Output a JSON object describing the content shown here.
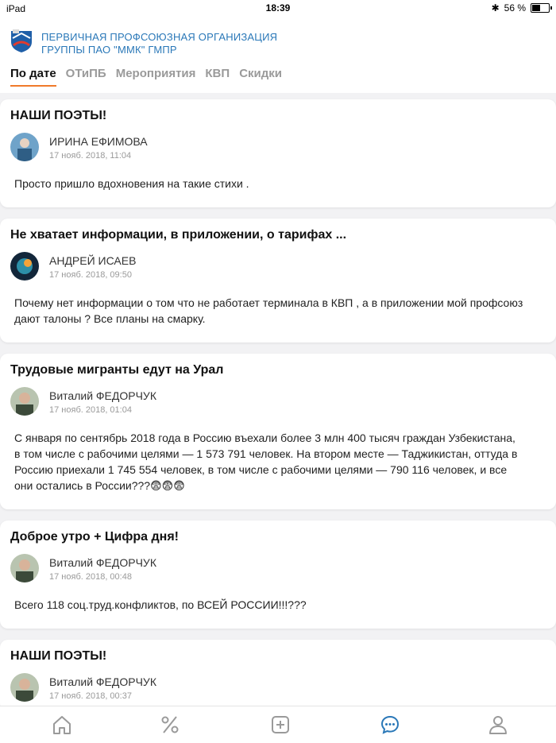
{
  "status_bar": {
    "left": "iPad",
    "time": "18:39",
    "battery_text": "56 %",
    "battery_level": 0.56
  },
  "header": {
    "org_line1": "ПЕРВИЧНАЯ ПРОФСОЮЗНАЯ ОРГАНИЗАЦИЯ",
    "org_line2": "ГРУППЫ ПАО \"ММК\" ГМПР",
    "tabs": [
      {
        "label": "По дате",
        "active": true
      },
      {
        "label": "ОТиПБ"
      },
      {
        "label": "Мероприятия"
      },
      {
        "label": "КВП"
      },
      {
        "label": "Скидки"
      }
    ]
  },
  "posts": [
    {
      "title": "НАШИ ПОЭТЫ!",
      "author": "ИРИНА ЕФИМОВА",
      "date": "17 нояб. 2018, 11:04",
      "body": "Просто пришло вдохновения на такие стихи ."
    },
    {
      "title": "Не хватает информации, в приложении, о тарифах ...",
      "author": "АНДРЕЙ ИСАЕВ",
      "date": "17 нояб. 2018, 09:50",
      "body": "Почему нет информации о том что не работает терминала в КВП , а в приложении мой профсоюз дают талоны ? Все планы на смарку."
    },
    {
      "title": "Трудовые мигранты едут на Урал",
      "author": "Виталий ФЕДОРЧУК",
      "date": "17 нояб. 2018, 01:04",
      "body": "С января по сентябрь 2018 года в Россию въехали более 3 млн 400 тысяч граждан Узбекистана, в том числе с рабочими целями — 1 573 791 человек. На втором месте — Таджикистан, оттуда в Россию приехали 1 745 554 человек, в том числе с рабочими целями — 790 116 человек, и все они остались в России???😨😨😨"
    },
    {
      "title": "Доброе утро + Цифра дня!",
      "author": "Виталий ФЕДОРЧУК",
      "date": "17 нояб. 2018, 00:48",
      "body": "Всего 118 соц.труд.конфликтов, по ВСЕЙ РОССИИ!!!???"
    },
    {
      "title": "НАШИ ПОЭТЫ!",
      "author": "Виталий ФЕДОРЧУК",
      "date": "17 нояб. 2018, 00:37",
      "body": ""
    }
  ],
  "bottom_nav": {
    "items": [
      "home-icon",
      "percent-icon",
      "add-icon",
      "chat-icon",
      "profile-icon"
    ],
    "active": "chat-icon",
    "accent": "#2a78b8"
  },
  "colors": {
    "accent_tab": "#f07a2a",
    "org_blue": "#2a78b8"
  }
}
